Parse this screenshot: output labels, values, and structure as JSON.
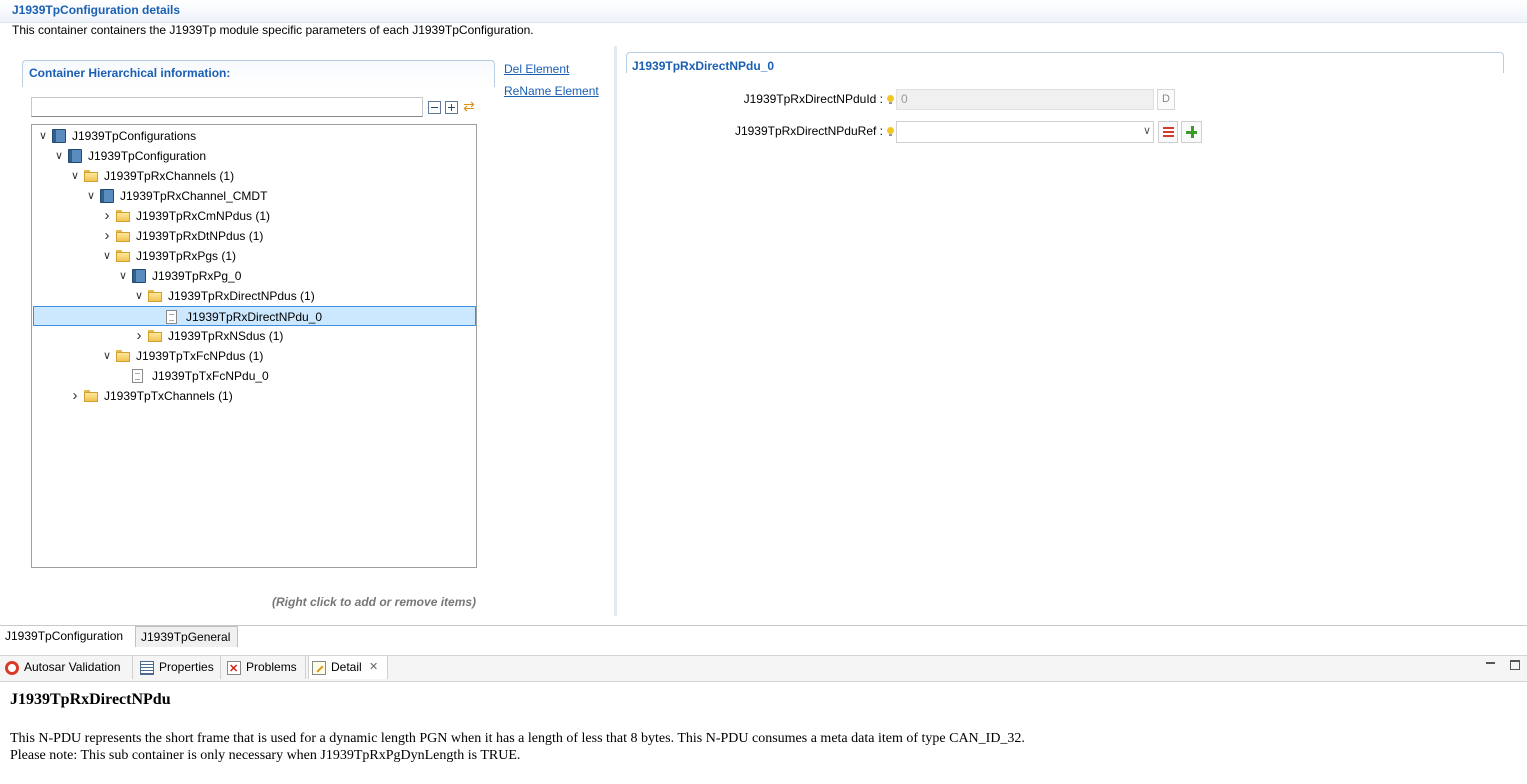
{
  "header": {
    "title": "J1939TpConfiguration details",
    "description": "This container containers the J1939Tp module specific parameters of each J1939TpConfiguration."
  },
  "left_panel": {
    "title": "Container Hierarchical information:",
    "filter_value": "",
    "hint": "(Right click to add or remove items)"
  },
  "actions": {
    "delete": "Del Element",
    "rename": "ReName Element"
  },
  "tree": [
    {
      "label": "J1939TpConfigurations",
      "icon": "container",
      "twisty": "expanded",
      "level": 0
    },
    {
      "label": "J1939TpConfiguration",
      "icon": "container",
      "twisty": "expanded",
      "level": 1
    },
    {
      "label": "J1939TpRxChannels (1)",
      "icon": "folder",
      "twisty": "expanded",
      "level": 2
    },
    {
      "label": "J1939TpRxChannel_CMDT",
      "icon": "container",
      "twisty": "expanded",
      "level": 3
    },
    {
      "label": "J1939TpRxCmNPdus (1)",
      "icon": "folder",
      "twisty": "collapsed",
      "level": 4
    },
    {
      "label": "J1939TpRxDtNPdus (1)",
      "icon": "folder",
      "twisty": "collapsed",
      "level": 4
    },
    {
      "label": "J1939TpRxPgs (1)",
      "icon": "folder",
      "twisty": "expanded",
      "level": 4
    },
    {
      "label": "J1939TpRxPg_0",
      "icon": "container",
      "twisty": "expanded",
      "level": 5
    },
    {
      "label": "J1939TpRxDirectNPdus (1)",
      "icon": "folder",
      "twisty": "expanded",
      "level": 6
    },
    {
      "label": "J1939TpRxDirectNPdu_0",
      "icon": "file",
      "twisty": "none",
      "level": 7,
      "selected": true
    },
    {
      "label": "J1939TpRxNSdus (1)",
      "icon": "folder",
      "twisty": "collapsed",
      "level": 6
    },
    {
      "label": "J1939TpTxFcNPdus (1)",
      "icon": "folder",
      "twisty": "expanded",
      "level": 4
    },
    {
      "label": "J1939TpTxFcNPdu_0",
      "icon": "file",
      "twisty": "none",
      "level": 5
    },
    {
      "label": "J1939TpTxChannels (1)",
      "icon": "folder",
      "twisty": "collapsed",
      "level": 2
    }
  ],
  "right_panel": {
    "title": "J1939TpRxDirectNPdu_0",
    "id_label": "J1939TpRxDirectNPduId :",
    "id_value": "0",
    "id_default_button": "D",
    "ref_label": "J1939TpRxDirectNPduRef :",
    "ref_value": ""
  },
  "editor_tabs": [
    "J1939TpConfiguration",
    "J1939TpGeneral"
  ],
  "view_tabs": {
    "validation": "Autosar Validation",
    "properties": "Properties",
    "problems": "Problems",
    "detail": "Detail"
  },
  "detail": {
    "title": "J1939TpRxDirectNPdu",
    "line1": "This N-PDU represents the short frame that is used for a dynamic length PGN when it has a length of less that 8 bytes. This N-PDU consumes a meta data item of type CAN_ID_32.",
    "line2": "Please note: This sub container is only necessary when J1939TpRxPgDynLength is TRUE."
  },
  "colors": {
    "accent": "#1a5fb4",
    "selection": "#cce8ff",
    "folder": "#f2c450"
  }
}
